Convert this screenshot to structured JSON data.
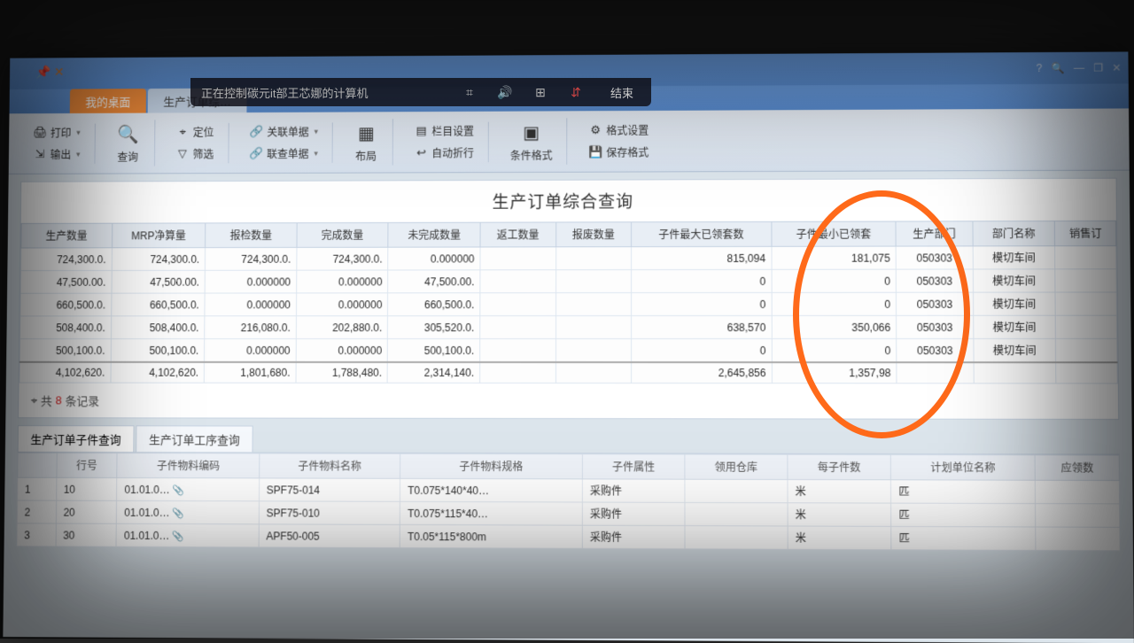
{
  "remote": {
    "status": "正在控制碳元it部王芯娜的计算机",
    "end": "结束"
  },
  "tabs": {
    "desktop": "我的桌面",
    "current": "生产订单综…"
  },
  "ribbon": {
    "print": "打印",
    "export": "输出",
    "query": "查询",
    "locate": "定位",
    "filter": "筛选",
    "relDoc": "关联单据",
    "joinDoc": "联查单据",
    "layout": "布局",
    "colSet": "栏目设置",
    "autoWrap": "自动折行",
    "condFmt": "条件格式",
    "fmtSet": "格式设置",
    "saveFmt": "保存格式"
  },
  "report": {
    "title": "生产订单综合查询"
  },
  "cols": {
    "c0": "生产数量",
    "c1": "MRP净算量",
    "c2": "报检数量",
    "c3": "完成数量",
    "c4": "未完成数量",
    "c5": "返工数量",
    "c6": "报废数量",
    "c7": "子件最大已领套数",
    "c8": "子件最小已领套",
    "c9": "生产部门",
    "c10": "部门名称",
    "c11": "销售订"
  },
  "rows": [
    {
      "c0": "724,300.0.",
      "c1": "724,300.0.",
      "c2": "724,300.0.",
      "c3": "724,300.0.",
      "c4": "0.000000",
      "c5": "",
      "c6": "",
      "c7": "815,094",
      "c8": "181,075",
      "c9": "050303",
      "c10": "模切车间",
      "c11": ""
    },
    {
      "c0": "47,500.00.",
      "c1": "47,500.00.",
      "c2": "0.000000",
      "c3": "0.000000",
      "c4": "47,500.00.",
      "c5": "",
      "c6": "",
      "c7": "0",
      "c8": "0",
      "c9": "050303",
      "c10": "模切车间",
      "c11": ""
    },
    {
      "c0": "660,500.0.",
      "c1": "660,500.0.",
      "c2": "0.000000",
      "c3": "0.000000",
      "c4": "660,500.0.",
      "c5": "",
      "c6": "",
      "c7": "0",
      "c8": "0",
      "c9": "050303",
      "c10": "模切车间",
      "c11": ""
    },
    {
      "c0": "508,400.0.",
      "c1": "508,400.0.",
      "c2": "216,080.0.",
      "c3": "202,880.0.",
      "c4": "305,520.0.",
      "c5": "",
      "c6": "",
      "c7": "638,570",
      "c8": "350,066",
      "c9": "050303",
      "c10": "模切车间",
      "c11": ""
    },
    {
      "c0": "500,100.0.",
      "c1": "500,100.0.",
      "c2": "0.000000",
      "c3": "0.000000",
      "c4": "500,100.0.",
      "c5": "",
      "c6": "",
      "c7": "0",
      "c8": "0",
      "c9": "050303",
      "c10": "模切车间",
      "c11": ""
    },
    {
      "c0": "4,102,620.",
      "c1": "4,102,620.",
      "c2": "1,801,680.",
      "c3": "1,788,480.",
      "c4": "2,314,140.",
      "c5": "",
      "c6": "",
      "c7": "2,645,856",
      "c8": "1,357,98",
      "c9": "",
      "c10": "",
      "c11": ""
    }
  ],
  "footer": {
    "prefix": "共",
    "count": "8",
    "suffix": "条记录"
  },
  "subtabs": {
    "t1": "生产订单子件查询",
    "t2": "生产订单工序查询"
  },
  "subcols": {
    "s0": "行号",
    "s1": "子件物料编码",
    "s2": "子件物料名称",
    "s3": "子件物料规格",
    "s4": "子件属性",
    "s5": "领用仓库",
    "s6": "每子件数",
    "s7": "计划单位名称",
    "s8": "应领数"
  },
  "subrows": [
    {
      "n": "1",
      "line": "10",
      "code": "01.01.0…",
      "name": "SPF75-014",
      "spec": "T0.075*140*40…",
      "attr": "采购件",
      "e": "米",
      "f": "匹"
    },
    {
      "n": "2",
      "line": "20",
      "code": "01.01.0…",
      "name": "SPF75-010",
      "spec": "T0.075*115*40…",
      "attr": "采购件",
      "e": "米",
      "f": "匹"
    },
    {
      "n": "3",
      "line": "30",
      "code": "01.01.0…",
      "name": "APF50-005",
      "spec": "T0.05*115*800m",
      "attr": "采购件",
      "e": "米",
      "f": "匹"
    }
  ]
}
